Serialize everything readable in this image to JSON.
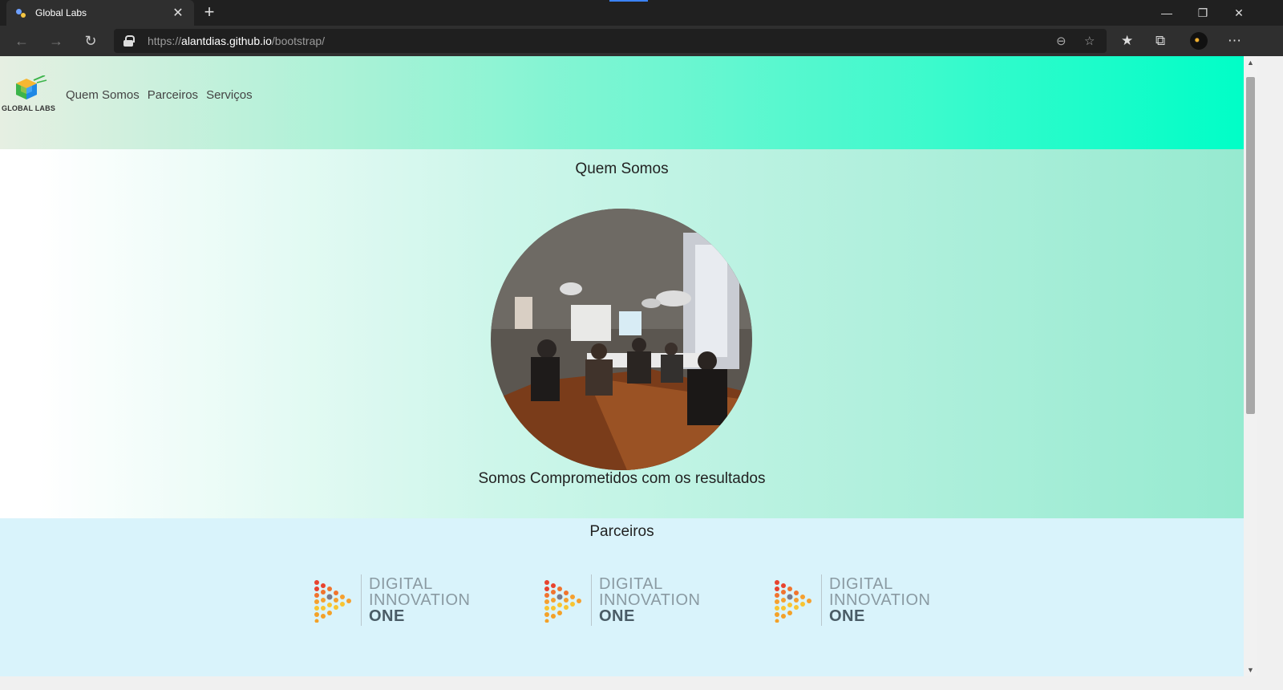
{
  "browser": {
    "tab_title": "Global Labs",
    "tab_close": "✕",
    "new_tab": "+",
    "url_scheme": "https://",
    "url_host": "alantdias.github.io",
    "url_path": "/bootstrap/"
  },
  "site": {
    "logo_text": "GLOBAL LABS",
    "nav": [
      "Quem Somos",
      "Parceiros",
      "Serviços"
    ],
    "about": {
      "title": "Quem Somos",
      "tagline": "Somos Comprometidos com os resultados"
    },
    "partners": {
      "title": "Parceiros",
      "items": [
        {
          "line1": "DIGITAL",
          "line2": "INNOVATION",
          "line3": "ONE"
        },
        {
          "line1": "DIGITAL",
          "line2": "INNOVATION",
          "line3": "ONE"
        },
        {
          "line1": "DIGITAL",
          "line2": "INNOVATION",
          "line3": "ONE"
        }
      ]
    }
  },
  "colors": {
    "header_gradient_end": "#00fec7",
    "partners_bg": "#d9f3fb"
  }
}
